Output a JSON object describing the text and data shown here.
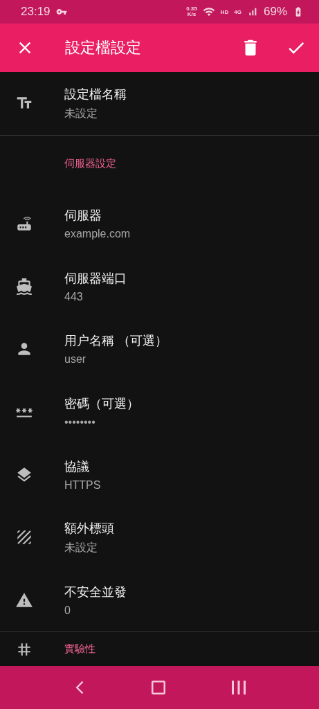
{
  "status_bar": {
    "time": "23:19",
    "speed": "0.35",
    "speed_unit": "K/s",
    "hd": "HD",
    "network": "4G",
    "battery": "69%"
  },
  "app_bar": {
    "title": "設定檔設定"
  },
  "sections": [
    {
      "items": [
        {
          "kind": "text",
          "title": "設定檔名稱",
          "value": "未設定"
        }
      ]
    },
    {
      "header": "伺服器設定",
      "items": [
        {
          "kind": "router",
          "title": "伺服器",
          "value": "example.com"
        },
        {
          "kind": "boat",
          "title": "伺服器端口",
          "value": "443"
        },
        {
          "kind": "person",
          "title": "用户名稱 （可選）",
          "value": "user"
        },
        {
          "kind": "password",
          "title": "密碼（可選）",
          "value": "••••••••"
        },
        {
          "kind": "layers",
          "title": "協議",
          "value": "HTTPS"
        },
        {
          "kind": "texture",
          "title": "額外標頭",
          "value": "未設定"
        },
        {
          "kind": "warning",
          "title": "不安全並發",
          "value": "0"
        }
      ]
    },
    {
      "header": "實驗性",
      "kind": "hash"
    }
  ]
}
